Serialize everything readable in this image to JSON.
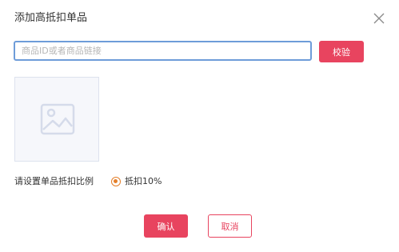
{
  "dialog": {
    "title": "添加高抵扣单品",
    "close_icon": "close-icon"
  },
  "search": {
    "value": "",
    "placeholder": "商品ID或者商品链接",
    "verify_label": "校验"
  },
  "preview": {
    "icon": "image-placeholder-icon"
  },
  "ratio": {
    "label": "请设置单品抵扣比例",
    "options": [
      {
        "label": "抵扣10%",
        "selected": true
      }
    ]
  },
  "footer": {
    "confirm_label": "确认",
    "cancel_label": "取消"
  },
  "colors": {
    "accent": "#e8445f",
    "radio": "#e47f2a",
    "input_focus_border": "#6e9cd9"
  }
}
